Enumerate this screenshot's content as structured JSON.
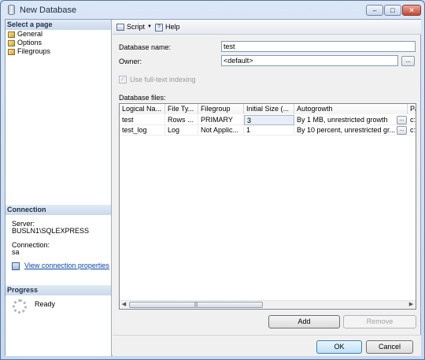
{
  "window": {
    "title": "New Database",
    "controls": {
      "minimize": "–",
      "maximize": "□",
      "close": "✕"
    }
  },
  "sidebar": {
    "select_page_header": "Select a page",
    "pages": [
      {
        "label": "General",
        "icon": "page-icon"
      },
      {
        "label": "Options",
        "icon": "page-icon"
      },
      {
        "label": "Filegroups",
        "icon": "page-icon"
      }
    ],
    "connection": {
      "header": "Connection",
      "server_label": "Server:",
      "server_value": "BUSLN1\\SQLEXPRESS",
      "connection_label": "Connection:",
      "connection_value": "sa",
      "view_properties_link": "View connection properties"
    },
    "progress": {
      "header": "Progress",
      "status": "Ready"
    }
  },
  "toolbar": {
    "script_label": "Script",
    "help_label": "Help"
  },
  "form": {
    "database_name_label": "Database name:",
    "database_name_value": "test",
    "owner_label": "Owner:",
    "owner_value": "<default>",
    "owner_browse": "...",
    "fulltext_label": "Use full-text indexing",
    "fulltext_checked": true,
    "fulltext_enabled": false
  },
  "database_files": {
    "label": "Database files:",
    "columns": [
      "Logical Na...",
      "File Ty...",
      "Filegroup",
      "Initial Size (...",
      "Autogrowth",
      "Pa"
    ],
    "rows": [
      {
        "logical_name": "test",
        "file_type": "Rows ...",
        "filegroup": "PRIMARY",
        "initial_size": "3",
        "autogrowth": "By 1 MB, unrestricted growth",
        "path": "c:\\"
      },
      {
        "logical_name": "test_log",
        "file_type": "Log",
        "filegroup": "Not Applic...",
        "initial_size": "1",
        "autogrowth": "By 10 percent, unrestricted gr...",
        "path": "c:\\"
      }
    ],
    "cell_button": "..."
  },
  "buttons": {
    "add": "Add",
    "remove": "Remove",
    "ok": "OK",
    "cancel": "Cancel"
  }
}
